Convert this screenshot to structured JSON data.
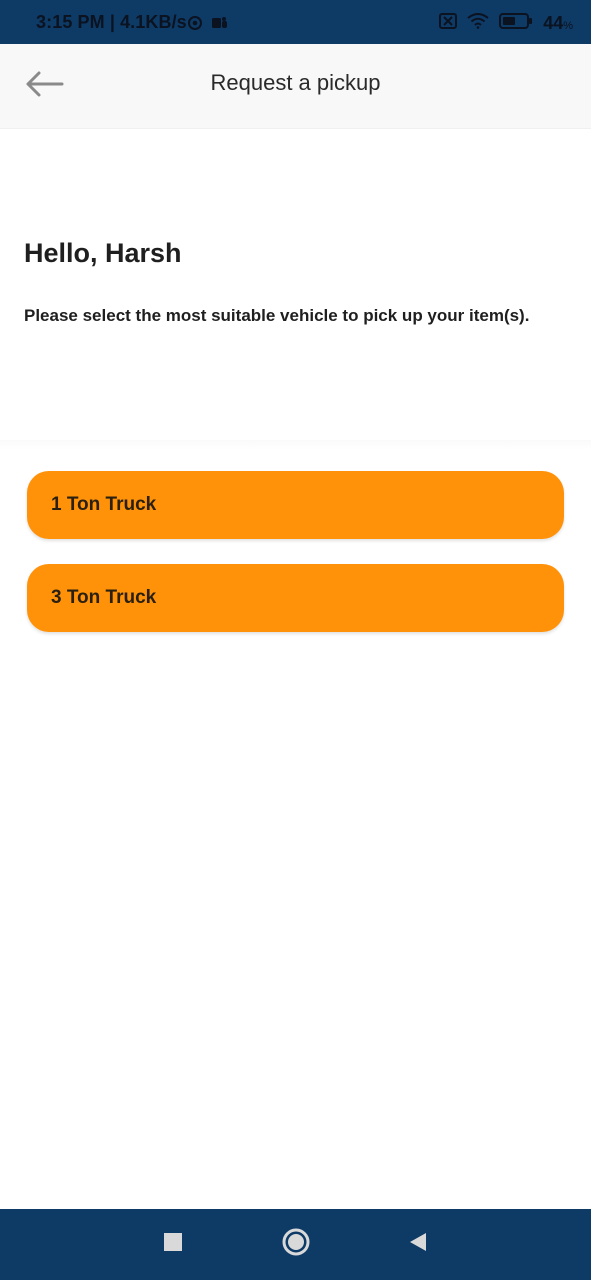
{
  "status_bar": {
    "time_and_speed": "3:15 PM | 4.1KB/s",
    "battery": "44",
    "icons": [
      "chrome-icon",
      "teams-icon",
      "no-sim-icon",
      "wifi-icon",
      "battery-icon"
    ]
  },
  "header": {
    "title": "Request a pickup",
    "back_icon": "arrow-left-icon"
  },
  "main": {
    "greeting": "Hello, Harsh",
    "instruction": "Please select the most suitable vehicle to pick up your item(s).",
    "vehicles": [
      {
        "label": "1 Ton Truck"
      },
      {
        "label": "3 Ton Truck"
      }
    ]
  },
  "navigation": {
    "items": [
      "recents-square-icon",
      "home-circle-icon",
      "back-triangle-icon"
    ]
  },
  "colors": {
    "status_bar": "#0e3a66",
    "app_bar": "#f8f8f8",
    "accent": "#ff9208",
    "nav_bar": "#0e3a66"
  }
}
